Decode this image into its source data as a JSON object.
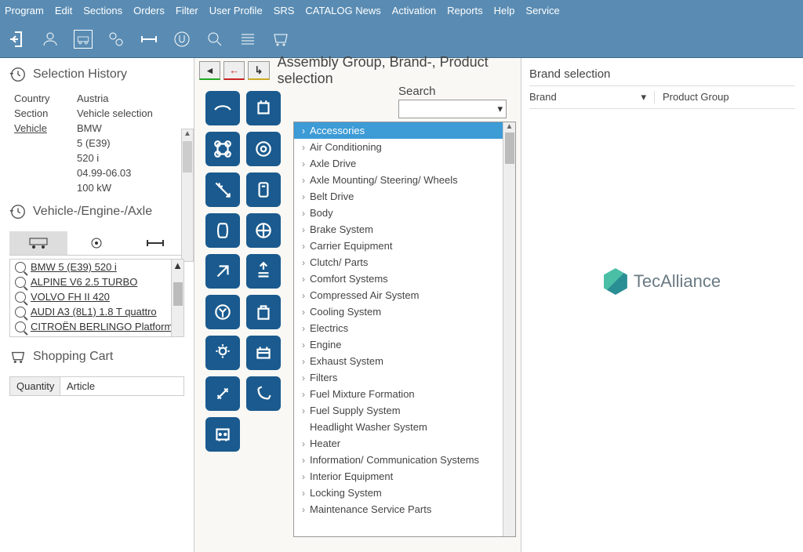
{
  "menubar": [
    "Program",
    "Edit",
    "Sections",
    "Orders",
    "Filter",
    "User Profile",
    "SRS",
    "CATALOG News",
    "Activation",
    "Reports",
    "Help",
    "Service"
  ],
  "sidebar": {
    "history_title": "Selection History",
    "kv": [
      {
        "k": "Country",
        "v": "Austria",
        "u": false
      },
      {
        "k": "Section",
        "v": "Vehicle selection",
        "u": false
      },
      {
        "k": "Vehicle",
        "v": "BMW",
        "u": true
      },
      {
        "k": "",
        "v": "5 (E39)",
        "u": false
      },
      {
        "k": "",
        "v": "520 i",
        "u": false
      },
      {
        "k": "",
        "v": "04.99-06.03",
        "u": false
      },
      {
        "k": "",
        "v": "100 kW",
        "u": false
      }
    ],
    "vea_title": "Vehicle-/Engine-/Axle",
    "vehicles": [
      "BMW 5 (E39) 520 i",
      "ALPINE V6 2.5 TURBO",
      "VOLVO FH II 420",
      "AUDI A3 (8L1) 1.8 T quattro",
      "CITROËN BERLINGO Platform/"
    ],
    "cart_title": "Shopping Cart",
    "cart_cols": {
      "qty": "Quantity",
      "art": "Article"
    }
  },
  "center": {
    "breadcrumb": "Assembly Group, Brand-, Product selection",
    "search_label": "Search",
    "assembly": [
      "Accessories",
      "Air Conditioning",
      "Axle Drive",
      "Axle Mounting/ Steering/ Wheels",
      "Belt Drive",
      "Body",
      "Brake System",
      "Carrier Equipment",
      "Clutch/ Parts",
      "Comfort Systems",
      "Compressed Air System",
      "Cooling System",
      "Electrics",
      "Engine",
      "Exhaust System",
      "Filters",
      "Fuel Mixture Formation",
      "Fuel Supply System",
      "Headlight Washer System",
      "Heater",
      "Information/ Communication Systems",
      "Interior Equipment",
      "Locking System",
      "Maintenance Service Parts"
    ]
  },
  "right": {
    "title": "Brand selection",
    "brand_col": "Brand",
    "product_col": "Product Group",
    "logo_text": "TecAlliance"
  }
}
